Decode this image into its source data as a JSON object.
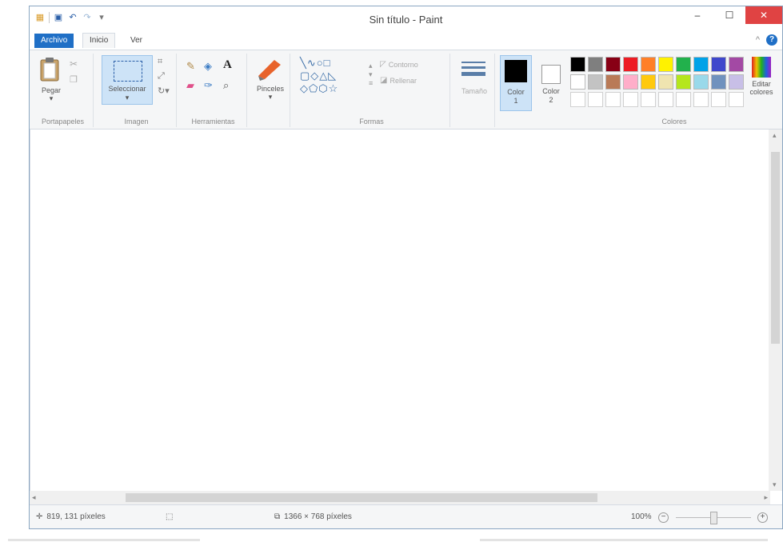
{
  "window": {
    "title": "Sin título - Paint",
    "controls": {
      "min": "–",
      "max": "☐",
      "close": "✕"
    }
  },
  "quick_access": [
    "paint-icon",
    "save-icon",
    "undo-icon",
    "redo-icon",
    "customize-icon"
  ],
  "tabs": {
    "file": "Archivo",
    "home": "Inicio",
    "view": "Ver",
    "collapse": "^",
    "help": "?"
  },
  "ribbon": {
    "clipboard": {
      "label": "Portapapeles",
      "paste": "Pegar"
    },
    "image": {
      "label": "Imagen",
      "select": "Seleccionar"
    },
    "tools": {
      "label": "Herramientas",
      "text": "A"
    },
    "brushes": {
      "label": "Pinceles"
    },
    "shapes": {
      "label": "Formas",
      "outline": "Contorno",
      "fill": "Rellenar"
    },
    "size": {
      "label": "Tamaño"
    },
    "color1": {
      "label": "Color",
      "num": "1"
    },
    "color2": {
      "label": "Color",
      "num": "2"
    },
    "colors": {
      "label": "Colores",
      "edit": "Editar",
      "edit2": "colores"
    }
  },
  "palette_top": [
    "#000000",
    "#7f7f7f",
    "#880015",
    "#ed1c24",
    "#ff7f27",
    "#fff200",
    "#22b14c",
    "#00a2e8",
    "#3f48cc",
    "#a349a4"
  ],
  "palette_mid": [
    "#ffffff",
    "#c3c3c3",
    "#b97a57",
    "#ffaec9",
    "#ffc90e",
    "#efe4b0",
    "#b5e61d",
    "#99d9ea",
    "#7092be",
    "#c8bfe7"
  ],
  "color1_value": "#000000",
  "color2_value": "#ffffff",
  "status": {
    "cursor": "819, 131 píxeles",
    "dimensions": "1366 × 768 píxeles",
    "zoom": "100%",
    "zoom_out": "−",
    "zoom_in": "+"
  },
  "zoom_level_fraction": 0.5
}
